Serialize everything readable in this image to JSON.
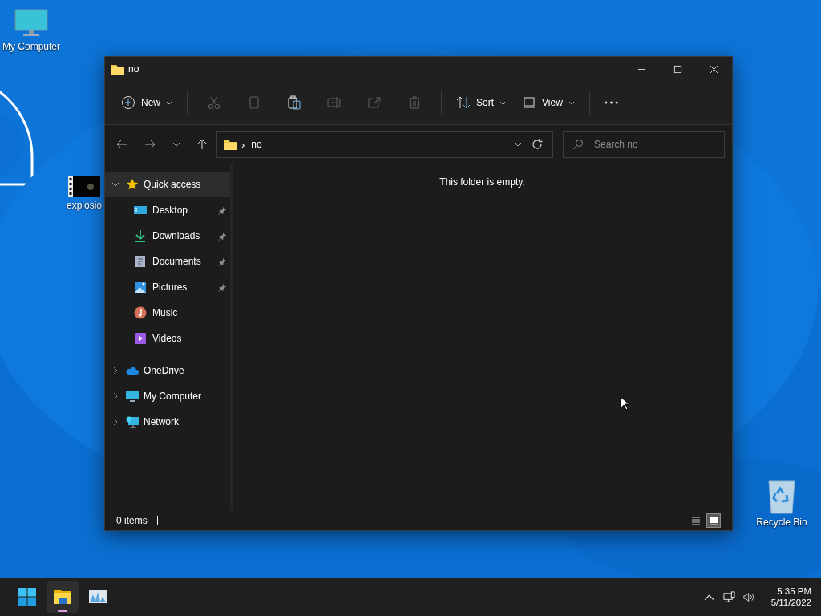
{
  "desktop_icons": [
    {
      "label": "My Computer",
      "kind": "computer"
    },
    {
      "label": "explosio",
      "kind": "video"
    },
    {
      "label": "Recycle Bin",
      "kind": "recycle"
    }
  ],
  "window": {
    "title": "no"
  },
  "toolbar": {
    "new": "New",
    "sort": "Sort",
    "view": "View",
    "actions": [
      {
        "kind": "cut",
        "disabled": true
      },
      {
        "kind": "copy",
        "disabled": true
      },
      {
        "kind": "paste",
        "disabled": false
      },
      {
        "kind": "rename",
        "disabled": true
      },
      {
        "kind": "share",
        "disabled": true
      },
      {
        "kind": "delete",
        "disabled": true
      }
    ]
  },
  "address": {
    "separator": "›",
    "path": "no"
  },
  "search": {
    "placeholder": "Search no"
  },
  "sidebar": {
    "items": [
      {
        "label": "Quick access",
        "kind": "star",
        "expanded": true,
        "selected": true,
        "children": [
          {
            "label": "Desktop",
            "kind": "desktop",
            "pinned": true,
            "selected": false
          },
          {
            "label": "Downloads",
            "kind": "download",
            "pinned": true,
            "selected": false
          },
          {
            "label": "Documents",
            "kind": "document",
            "pinned": true,
            "selected": false
          },
          {
            "label": "Pictures",
            "kind": "pictures",
            "pinned": true,
            "selected": false
          },
          {
            "label": "Music",
            "kind": "music",
            "pinned": false,
            "selected": false
          },
          {
            "label": "Videos",
            "kind": "videos",
            "pinned": false,
            "selected": false
          }
        ]
      },
      {
        "label": "OneDrive",
        "kind": "cloud",
        "expanded": false,
        "selected": false
      },
      {
        "label": "My Computer",
        "kind": "computer",
        "expanded": false,
        "selected": false
      },
      {
        "label": "Network",
        "kind": "network",
        "expanded": false,
        "selected": false
      }
    ]
  },
  "content": {
    "message": "This folder is empty."
  },
  "status_bar": {
    "count": "0 items",
    "views": [
      {
        "kind": "details",
        "selected": false
      },
      {
        "kind": "tiles",
        "selected": true
      }
    ]
  },
  "taskbar": {
    "apps": [
      {
        "kind": "start",
        "active": false
      },
      {
        "kind": "explorer",
        "active": true
      },
      {
        "kind": "monitor",
        "active": false
      }
    ],
    "time": "5:35 PM",
    "date": "5/11/2022"
  }
}
